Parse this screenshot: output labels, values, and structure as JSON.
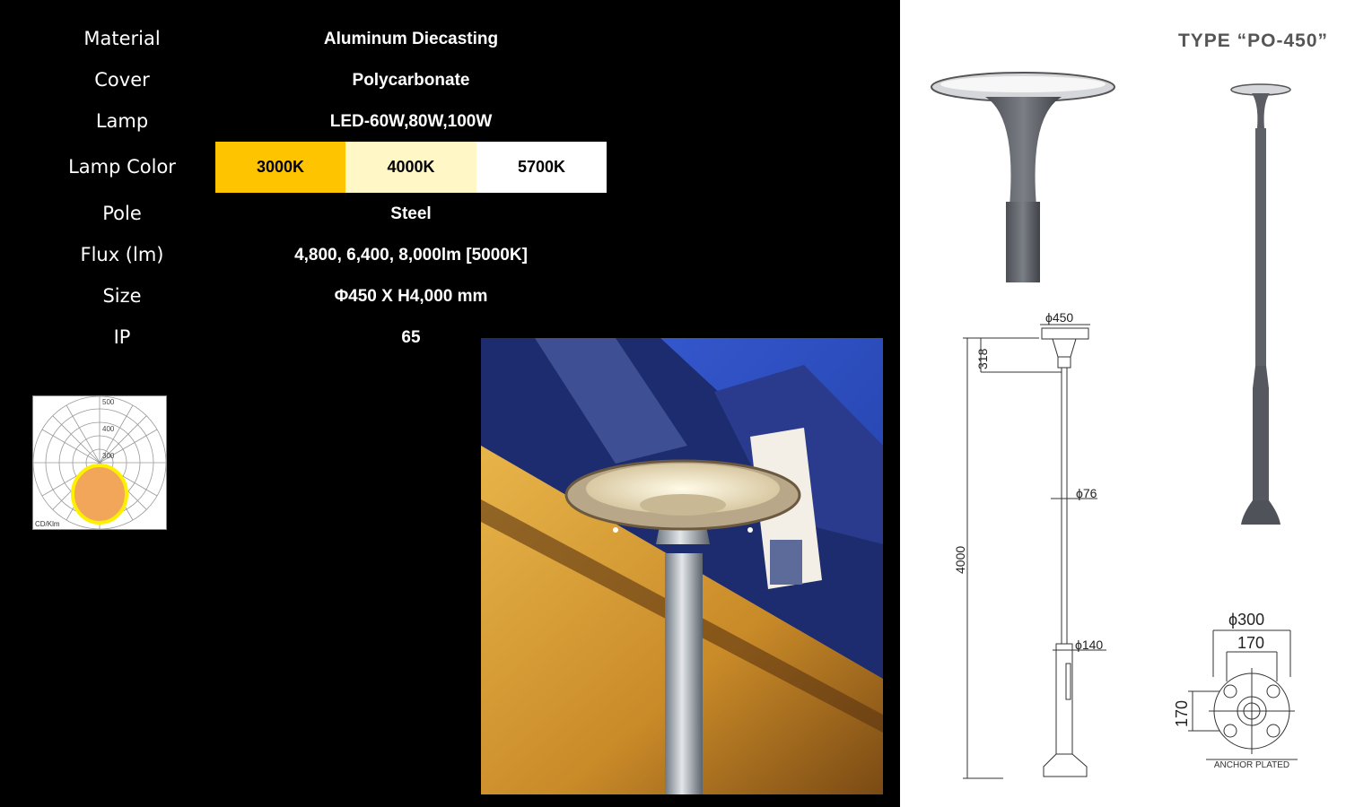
{
  "specs": {
    "material": {
      "label": "Material",
      "value": "Aluminum Diecasting"
    },
    "cover": {
      "label": "Cover",
      "value": "Polycarbonate"
    },
    "lamp": {
      "label": "Lamp",
      "value": "LED-60W,80W,100W"
    },
    "lamp_color": {
      "label": "Lamp Color",
      "options": [
        {
          "label": "3000K",
          "color": "#FFC400"
        },
        {
          "label": "4000K",
          "color": "#FFF7C6"
        },
        {
          "label": "5700K",
          "color": "#FFFFFF"
        }
      ]
    },
    "pole": {
      "label": "Pole",
      "value": "Steel"
    },
    "flux": {
      "label": "Flux (lm)",
      "value": "4,800,  6,400,  8,000lm  [5000K]"
    },
    "size": {
      "label": "Size",
      "value": "Φ450  X  H4,000  mm"
    },
    "ip": {
      "label": "IP",
      "value": "65"
    }
  },
  "polar_chart": {
    "rings": [
      "500",
      "400",
      "300"
    ],
    "unit": "CD/Klm"
  },
  "product": {
    "type_title": "TYPE “PO-450”"
  },
  "dimensions": {
    "head_diameter": "ϕ450",
    "head_height": "318",
    "pole_diameter_upper": "ϕ76",
    "total_height": "4000",
    "pole_diameter_lower": "ϕ140",
    "base_diameter": "ϕ300",
    "bolt_spacing_x": "170",
    "bolt_spacing_y": "170",
    "anchor_label": "ANCHOR PLATED"
  }
}
